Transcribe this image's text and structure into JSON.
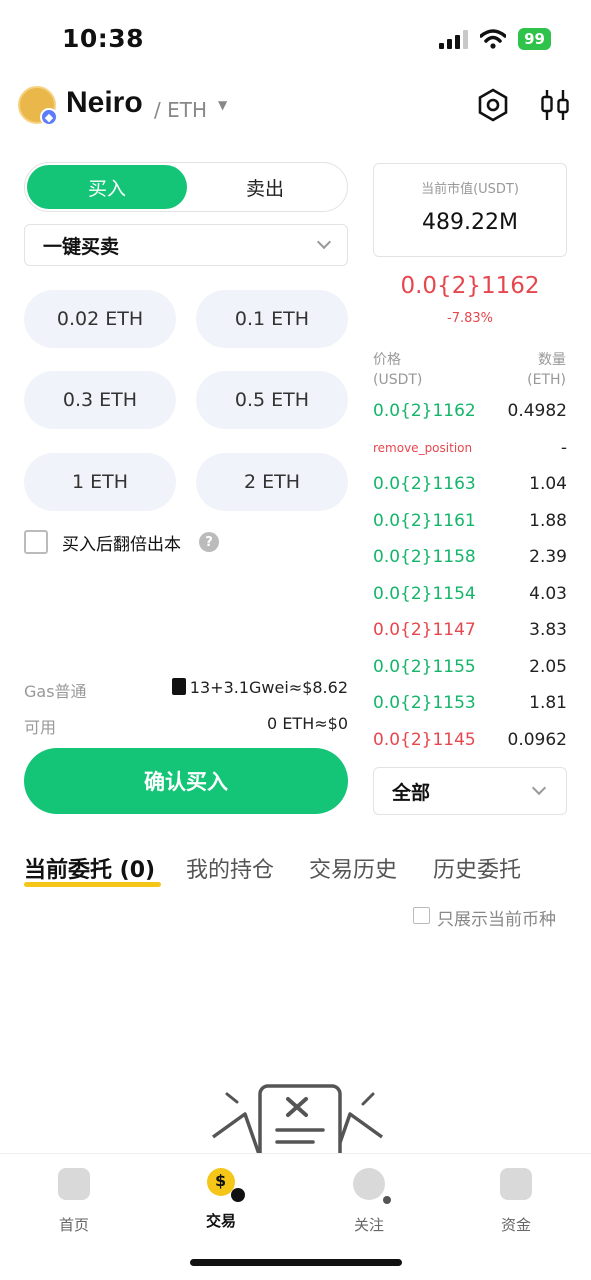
{
  "status_bar": {
    "time": "10:38",
    "battery": "99"
  },
  "header": {
    "token_name": "Neiro",
    "chain": "/ ETH"
  },
  "trade": {
    "buy_tab": "买入",
    "sell_tab": "卖出",
    "order_type": "一键买卖",
    "amounts": [
      "0.02 ETH",
      "0.1 ETH",
      "0.3 ETH",
      "0.5 ETH",
      "1 ETH",
      "2 ETH"
    ],
    "double_exit_label": "买入后翻倍出本",
    "help": "?",
    "gas_label": "Gas普通",
    "gas_value": "13+3.1Gwei≈$8.62",
    "available_label": "可用",
    "available_value": "0 ETH≈$0",
    "confirm_label": "确认买入"
  },
  "market": {
    "market_cap_label": "当前市值(USDT)",
    "market_cap_value": "489.22M",
    "price": "0.0{2}1162",
    "change": "-7.83%",
    "price_header": [
      "价格",
      "(USDT)"
    ],
    "qty_header": [
      "数量",
      "(ETH)"
    ],
    "rows": [
      {
        "price": "0.0{2}1162",
        "qty": "0.4982",
        "side": "buy"
      },
      {
        "price": "remove_position",
        "qty": "-",
        "side": "sell"
      },
      {
        "price": "0.0{2}1163",
        "qty": "1.04",
        "side": "buy"
      },
      {
        "price": "0.0{2}1161",
        "qty": "1.88",
        "side": "buy"
      },
      {
        "price": "0.0{2}1158",
        "qty": "2.39",
        "side": "buy"
      },
      {
        "price": "0.0{2}1154",
        "qty": "4.03",
        "side": "buy"
      },
      {
        "price": "0.0{2}1147",
        "qty": "3.83",
        "side": "sell"
      },
      {
        "price": "0.0{2}1155",
        "qty": "2.05",
        "side": "buy"
      },
      {
        "price": "0.0{2}1153",
        "qty": "1.81",
        "side": "buy"
      },
      {
        "price": "0.0{2}1145",
        "qty": "0.0962",
        "side": "sell"
      }
    ],
    "filter": "全部"
  },
  "orders": {
    "tabs": [
      "当前委托 (0)",
      "我的持仓",
      "交易历史",
      "历史委托"
    ],
    "only_current_label": "只展示当前币种"
  },
  "bottom_nav": {
    "items": [
      {
        "label": "首页",
        "icon": "home-icon"
      },
      {
        "label": "交易",
        "icon": "trade-icon"
      },
      {
        "label": "关注",
        "icon": "follow-icon"
      },
      {
        "label": "资金",
        "icon": "wallet-icon"
      }
    ]
  },
  "colors": {
    "accent_green": "#14c578",
    "price_red": "#e6474e",
    "tab_underline": "#f5c518"
  }
}
